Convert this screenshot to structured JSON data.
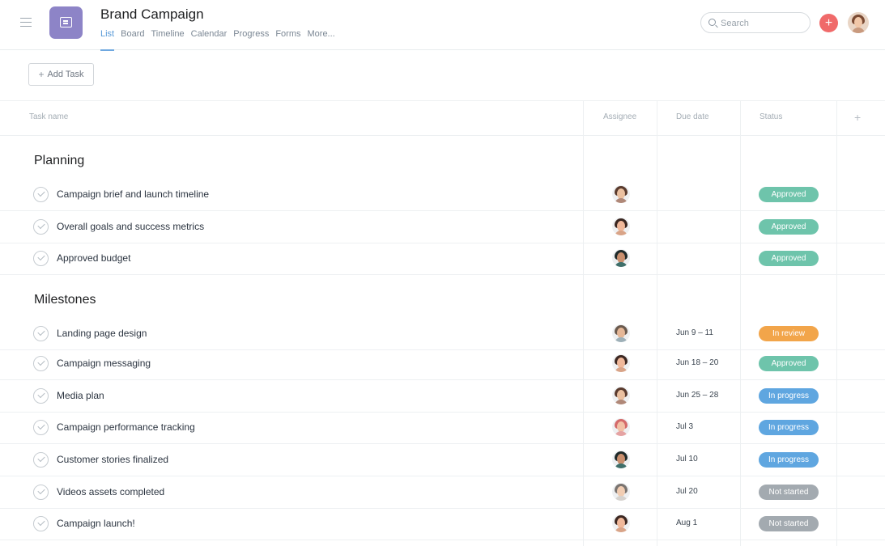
{
  "header": {
    "title": "Brand Campaign",
    "tabs": [
      "List",
      "Board",
      "Timeline",
      "Calendar",
      "Progress",
      "Forms",
      "More..."
    ],
    "active_tab": "List",
    "search_placeholder": "Search",
    "plus_label": "+"
  },
  "toolbar": {
    "add_task_label": "Add Task",
    "add_task_plus": "+"
  },
  "columns": {
    "task": "Task name",
    "assignee": "Assignee",
    "due": "Due date",
    "status": "Status",
    "add": "+"
  },
  "status_colors": {
    "Approved": "#6ec4ab",
    "In review": "#f2a54a",
    "In progress": "#5fa6e0",
    "Not started": "#a3aab0"
  },
  "sections": [
    {
      "title": "Planning",
      "tasks": [
        {
          "name": "Campaign brief and launch timeline",
          "due": "",
          "status": "Approved"
        },
        {
          "name": "Overall goals and success metrics",
          "due": "",
          "status": "Approved"
        },
        {
          "name": "Approved budget",
          "due": "",
          "status": "Approved"
        }
      ]
    },
    {
      "title": "Milestones",
      "tasks": [
        {
          "name": "Landing page design",
          "due": "Jun 9 – 11",
          "status": "In review"
        },
        {
          "name": "Campaign messaging",
          "due": "Jun 18 – 20",
          "status": "Approved"
        },
        {
          "name": "Media plan",
          "due": "Jun 25 – 28",
          "status": "In progress"
        },
        {
          "name": "Campaign performance tracking",
          "due": "Jul 3",
          "status": "In progress"
        },
        {
          "name": "Customer stories finalized",
          "due": "Jul 10",
          "status": "In progress"
        },
        {
          "name": "Videos assets completed",
          "due": "Jul 20",
          "status": "Not started"
        },
        {
          "name": "Campaign launch!",
          "due": "Aug 1",
          "status": "Not started"
        }
      ]
    }
  ]
}
